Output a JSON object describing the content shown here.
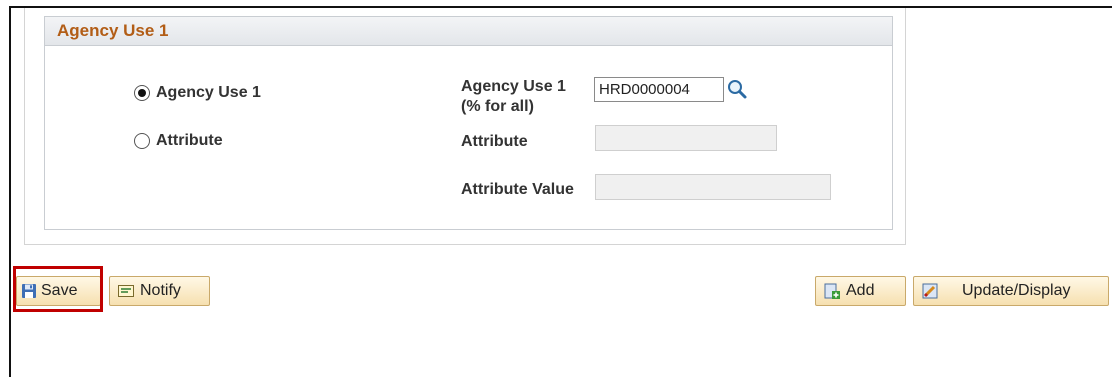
{
  "group": {
    "title": "Agency Use 1"
  },
  "options": {
    "agency_use_radio_label": "Agency Use 1",
    "attribute_radio_label": "Attribute",
    "selected": "agency_use"
  },
  "fields": {
    "agency_use_label_line1": "Agency Use 1",
    "agency_use_label_line2": "(% for all)",
    "agency_use_value": "HRD0000004",
    "attribute_label": "Attribute",
    "attribute_value": "",
    "attribute_value_label": "Attribute Value",
    "attribute_value_value": ""
  },
  "buttons": {
    "save": "Save",
    "notify": "Notify",
    "add": "Add",
    "update_display": "Update/Display"
  },
  "icons": {
    "lookup": "search-icon",
    "save": "floppy-disk-icon",
    "notify": "notify-icon",
    "add": "add-page-icon",
    "update_display": "pencil-edit-icon"
  },
  "colors": {
    "group_title": "#b25d16",
    "highlight_border": "#c00000",
    "button_bg": "#f6e0b0"
  }
}
